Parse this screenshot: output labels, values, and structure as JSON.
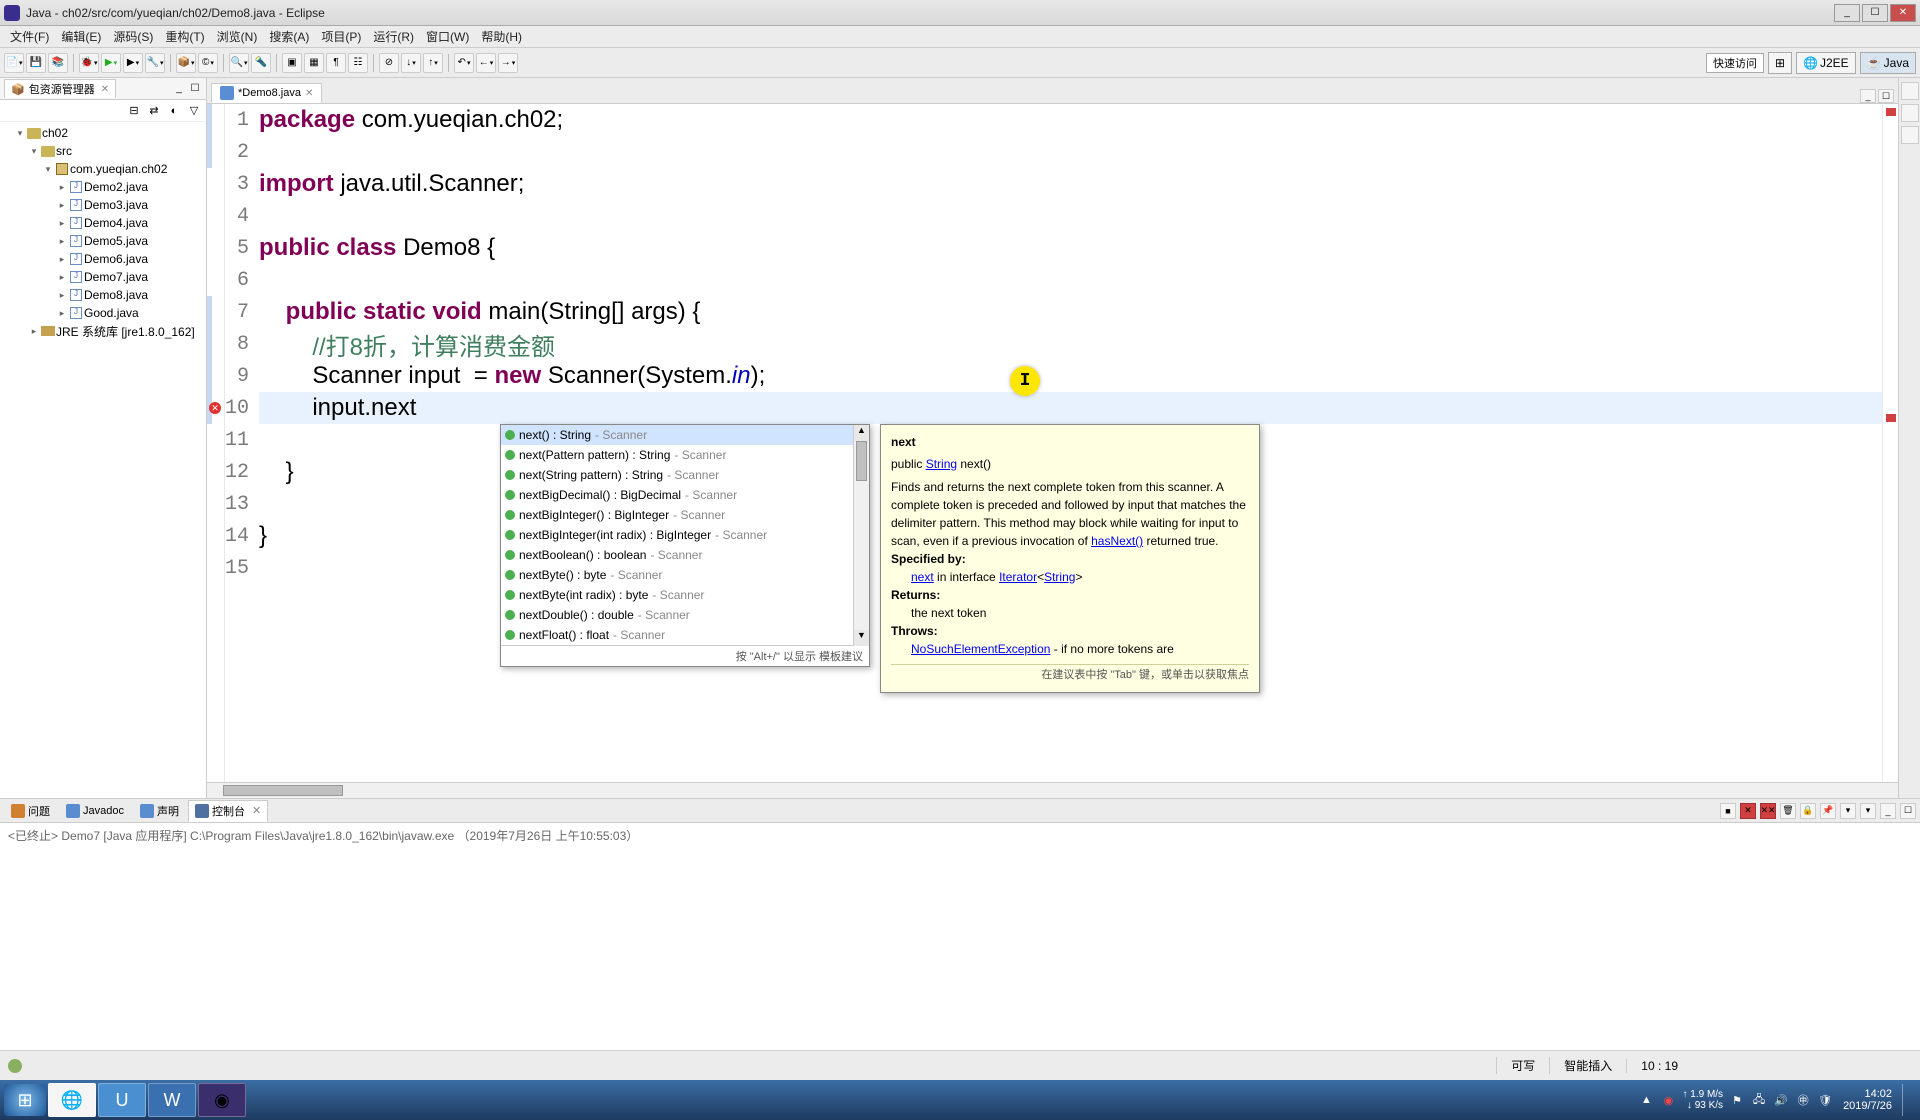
{
  "title": "Java - ch02/src/com/yueqian/ch02/Demo8.java - Eclipse",
  "menus": [
    "文件(F)",
    "编辑(E)",
    "源码(S)",
    "重构(T)",
    "浏览(N)",
    "搜索(A)",
    "项目(P)",
    "运行(R)",
    "窗口(W)",
    "帮助(H)"
  ],
  "quick_access": "快速访问",
  "perspectives": {
    "j2ee": "J2EE",
    "java": "Java"
  },
  "sidebar": {
    "title": "包资源管理器",
    "tree": {
      "project": "ch02",
      "src": "src",
      "pkg": "com.yueqian.ch02",
      "files": [
        "Demo2.java",
        "Demo3.java",
        "Demo4.java",
        "Demo5.java",
        "Demo6.java",
        "Demo7.java",
        "Demo8.java",
        "Good.java"
      ],
      "jre": "JRE 系统库 [jre1.8.0_162]"
    }
  },
  "editor": {
    "tab": "*Demo8.java",
    "lines": {
      "l1": {
        "pkg": "package ",
        "rest": "com.yueqian.ch02;"
      },
      "l3": {
        "imp": "import ",
        "rest": "java.util.Scanner;"
      },
      "l5": {
        "a": "public class ",
        "cls": "Demo8 {"
      },
      "l7": {
        "a": "    public static void ",
        "m": "main(String[] args) {"
      },
      "l8": "        //打8折，计算消费金额",
      "l9": {
        "a": "        Scanner input  = ",
        "n": "new ",
        "b": "Scanner(System.",
        "c": "in",
        "d": ");"
      },
      "l10": "        input.next",
      "l12": "    }",
      "l14": "}"
    }
  },
  "autocomplete": {
    "items": [
      {
        "m": "next() : String",
        "t": "Scanner"
      },
      {
        "m": "next(Pattern pattern) : String",
        "t": "Scanner"
      },
      {
        "m": "next(String pattern) : String",
        "t": "Scanner"
      },
      {
        "m": "nextBigDecimal() : BigDecimal",
        "t": "Scanner"
      },
      {
        "m": "nextBigInteger() : BigInteger",
        "t": "Scanner"
      },
      {
        "m": "nextBigInteger(int radix) : BigInteger",
        "t": "Scanner"
      },
      {
        "m": "nextBoolean() : boolean",
        "t": "Scanner"
      },
      {
        "m": "nextByte() : byte",
        "t": "Scanner"
      },
      {
        "m": "nextByte(int radix) : byte",
        "t": "Scanner"
      },
      {
        "m": "nextDouble() : double",
        "t": "Scanner"
      },
      {
        "m": "nextFloat() : float",
        "t": "Scanner"
      }
    ],
    "footer": "按 \"Alt+/\" 以显示 模板建议"
  },
  "doc": {
    "name": "next",
    "sig_pre": "public ",
    "sig_link": "String",
    "sig_post": " next()",
    "body": "Finds and returns the next complete token from this scanner. A complete token is preceded and followed by input that matches the delimiter pattern. This method may block while waiting for input to scan, even if a previous invocation of ",
    "hasnext": "hasNext()",
    "body2": " returned true.",
    "specby": "Specified by:",
    "spec_line_a": "next",
    "spec_line_b": " in interface ",
    "spec_line_c": "Iterator",
    "spec_line_d": "<",
    "spec_line_e": "String",
    "spec_line_f": ">",
    "returns": "Returns:",
    "returns_v": "the next token",
    "throws": "Throws:",
    "throws_l": "NoSuchElementException",
    "throws_t": " - if no more tokens are",
    "footer": "在建议表中按 \"Tab\" 键，或单击以获取焦点"
  },
  "console": {
    "tabs": {
      "problems": "问题",
      "javadoc": "Javadoc",
      "declaration": "声明",
      "console": "控制台"
    },
    "status": "<已终止> Demo7 [Java 应用程序] C:\\Program Files\\Java\\jre1.8.0_162\\bin\\javaw.exe （2019年7月26日 上午10:55:03）"
  },
  "status": {
    "writable": "可写",
    "insert": "智能插入",
    "pos": "10 : 19"
  },
  "taskbar": {
    "net_speed_up": "1.9 M/s",
    "net_speed_down": "93 K/s",
    "time": "14:02",
    "date": "2019/7/26"
  }
}
